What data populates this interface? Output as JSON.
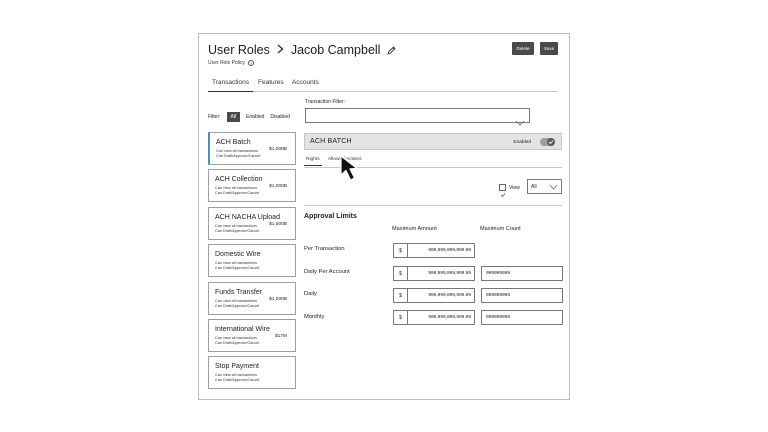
{
  "header": {
    "breadcrumb_root": "User Roles",
    "user_name": "Jacob Campbell",
    "subtitle": "User Role Policy",
    "delete_label": "Delete",
    "save_label": "Save"
  },
  "tabs": [
    {
      "label": "Transactions",
      "active": true
    },
    {
      "label": "Features",
      "active": false
    },
    {
      "label": "Accounts",
      "active": false
    }
  ],
  "filter": {
    "label": "Filter:",
    "options": [
      "All",
      "Enabled",
      "Disabled"
    ],
    "selected": "All"
  },
  "transaction_filter": {
    "label": "Transaction Filter:",
    "value": ""
  },
  "transactions": [
    {
      "name": "ACH Batch",
      "line1": "Can view all transactions",
      "line2": "Can Draft/Approve/Cancel",
      "amount": "$1,000B",
      "selected": true
    },
    {
      "name": "ACH Collection",
      "line1": "Can view all transactions",
      "line2": "Can Draft/Approve/Cancel",
      "amount": "$1,000B",
      "selected": false
    },
    {
      "name": "ACH NACHA Upload",
      "line1": "Can view all transactions",
      "line2": "Can Draft/Approve/Cancel",
      "amount": "$1,000B",
      "selected": false
    },
    {
      "name": "Domestic Wire",
      "line1": "Can view all transactions",
      "line2": "Can Draft/Approve/Cancel",
      "amount": "",
      "selected": false
    },
    {
      "name": "Funds Transfer",
      "line1": "Can view all transactions",
      "line2": "Can Draft/Approve/Cancel",
      "amount": "$1,000B",
      "selected": false
    },
    {
      "name": "International Wire",
      "line1": "Can view all transactions",
      "line2": "Can Draft/Approve/Cancel",
      "amount": "$17M",
      "selected": false
    },
    {
      "name": "Stop Payment",
      "line1": "Can view all transactions",
      "line2": "Can Draft/Approve/Cancel",
      "amount": "",
      "selected": false
    }
  ],
  "detail": {
    "title": "ACH BATCH",
    "enabled_label": "Enabled",
    "enabled": true,
    "subtabs": [
      {
        "label": "Rights",
        "active": true
      },
      {
        "label": "Allowed Actions",
        "active": false
      }
    ],
    "view_label": "View",
    "view_select": "All",
    "approval_title": "Approval Limits",
    "col_amount": "Maximum Amount",
    "col_count": "Maximum Count",
    "limits": [
      {
        "label": "Per Transaction",
        "currency": "$",
        "amount": "999,999,999,999.99",
        "count": null
      },
      {
        "label": "Daily Per Account",
        "currency": "$",
        "amount": "999,999,999,999.99",
        "count": "999999999"
      },
      {
        "label": "Daily",
        "currency": "$",
        "amount": "999,999,999,999.99",
        "count": "999999999"
      },
      {
        "label": "Monthly",
        "currency": "$",
        "amount": "999,999,999,999.99",
        "count": "999999999"
      }
    ]
  },
  "colors": {
    "accent": "#4a90c2",
    "button_dark": "#4a4a4a",
    "panel_gray": "#e3e3e3"
  }
}
